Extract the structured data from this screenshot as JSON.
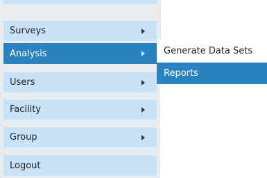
{
  "menu": {
    "items": [
      {
        "label": "Surveys",
        "has_submenu": true
      },
      {
        "label": "Analysis",
        "has_submenu": true,
        "active": true
      },
      {
        "label": "Users",
        "has_submenu": true
      },
      {
        "label": "Facility",
        "has_submenu": true
      },
      {
        "label": "Group",
        "has_submenu": true
      },
      {
        "label": "Logout",
        "has_submenu": false
      }
    ]
  },
  "submenu": {
    "items": [
      {
        "label": "Generate Data Sets"
      },
      {
        "label": "Reports",
        "active": true
      }
    ]
  },
  "colors": {
    "menu_item_bg": "#c8e3f8",
    "active_bg": "#2b82c0",
    "menu_panel_bg": "#e9ecef"
  }
}
